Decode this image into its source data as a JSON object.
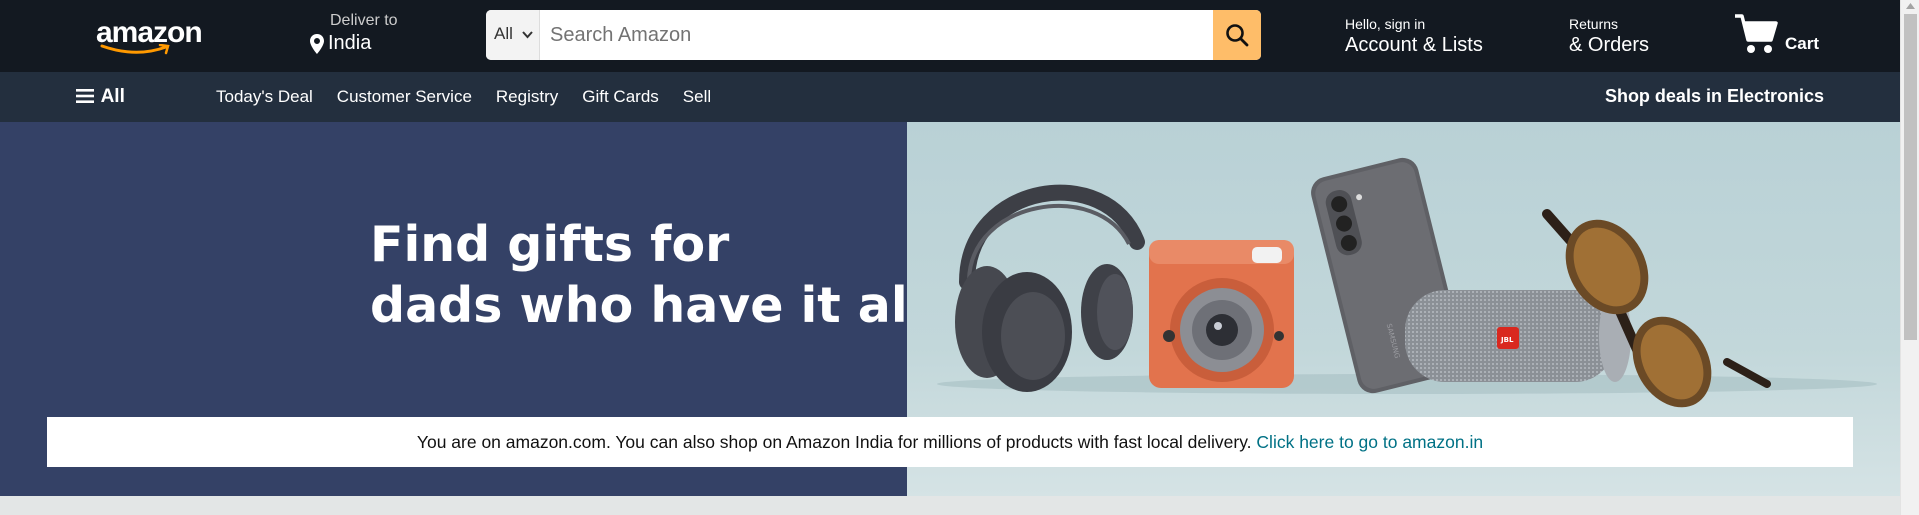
{
  "logo": {
    "text": "amazon"
  },
  "deliver": {
    "label": "Deliver to",
    "location": "India"
  },
  "search": {
    "category": "All",
    "placeholder": "Search Amazon",
    "value": ""
  },
  "account": {
    "greeting": "Hello, sign in",
    "label": "Account & Lists"
  },
  "orders": {
    "top": "Returns",
    "label": "& Orders"
  },
  "cart": {
    "label": "Cart"
  },
  "subnav": {
    "all_label": "All",
    "links": [
      "Today's Deal",
      "Customer Service",
      "Registry",
      "Gift Cards",
      "Sell"
    ],
    "promo": "Shop deals in Electronics"
  },
  "hero": {
    "title_line1": "Find gifts for",
    "title_line2": "dads who have it all"
  },
  "notice": {
    "text": "You are on amazon.com. You can also shop on Amazon India for millions of products with fast local delivery. ",
    "link": "Click here to go to amazon.in"
  },
  "colors": {
    "nav_bg": "#131921",
    "subnav_bg": "#232f3e",
    "search_button": "#febd69",
    "hero_left": "#344166",
    "hero_right": "#c2d7da",
    "link": "#007185"
  }
}
